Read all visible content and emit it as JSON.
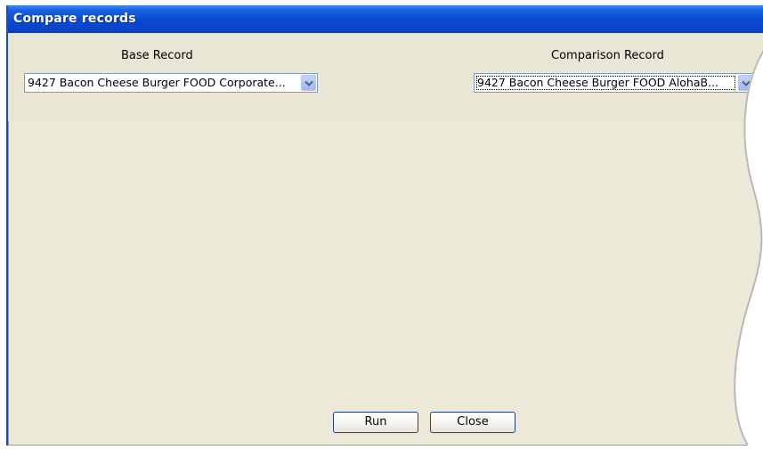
{
  "window": {
    "title": "Compare records"
  },
  "base": {
    "label": "Base Record",
    "selected": "9427 Bacon Cheese Burger FOOD Corporate..."
  },
  "comparison": {
    "label": "Comparison Record",
    "selected": "9427 Bacon Cheese Burger FOOD AlohaB..."
  },
  "buttons": {
    "run": "Run",
    "close": "Close"
  },
  "colors": {
    "titlebar": "#0A4BD6",
    "dialog_bg": "#ECE9D8"
  },
  "icons": {
    "dropdown": "chevron-down-icon"
  }
}
